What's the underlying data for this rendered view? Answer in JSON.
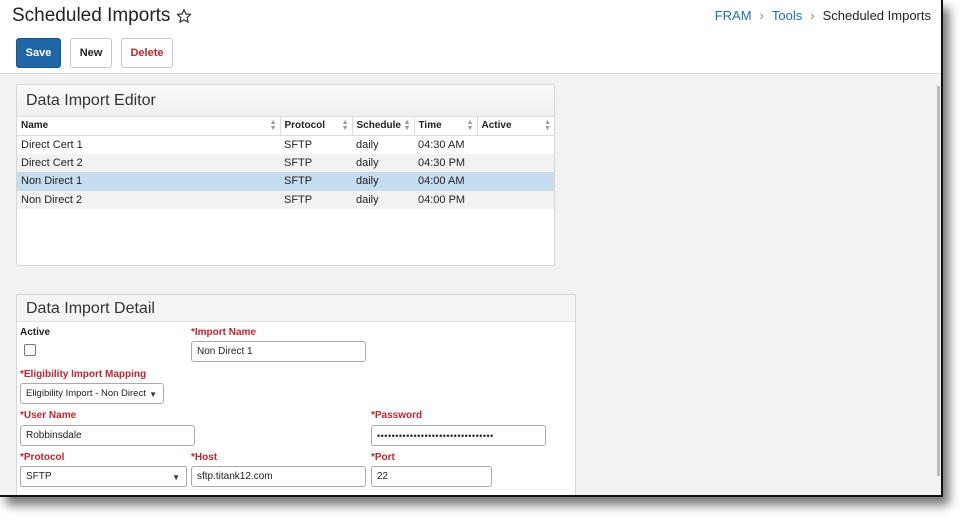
{
  "header": {
    "title": "Scheduled Imports",
    "breadcrumb": [
      "FRAM",
      "Tools",
      "Scheduled Imports"
    ]
  },
  "toolbar": {
    "save_label": "Save",
    "new_label": "New",
    "delete_label": "Delete"
  },
  "editor": {
    "title": "Data Import Editor",
    "columns": [
      "Name",
      "Protocol",
      "Schedule",
      "Time",
      "Active"
    ],
    "rows": [
      {
        "name": "Direct Cert 1",
        "protocol": "SFTP",
        "schedule": "daily",
        "time": "04:30 AM",
        "active": ""
      },
      {
        "name": "Direct Cert 2",
        "protocol": "SFTP",
        "schedule": "daily",
        "time": "04:30 PM",
        "active": ""
      },
      {
        "name": "Non Direct 1",
        "protocol": "SFTP",
        "schedule": "daily",
        "time": "04:00 AM",
        "active": ""
      },
      {
        "name": "Non Direct 2",
        "protocol": "SFTP",
        "schedule": "daily",
        "time": "04:00 PM",
        "active": ""
      }
    ],
    "selected_row": 2
  },
  "detail": {
    "title": "Data Import Detail",
    "active_label": "Active",
    "active_checked": false,
    "import_name_label": "*Import Name",
    "import_name_value": "Non Direct 1",
    "mapping_label": "*Eligibility Import Mapping",
    "mapping_value": "Eligibility Import - Non Direct",
    "user_name_label": "*User Name",
    "user_name_value": "Robbinsdale",
    "password_label": "*Password",
    "password_value": "••••••••••••••••••••••••••••••••",
    "protocol_label": "*Protocol",
    "protocol_value": "SFTP",
    "host_label": "*Host",
    "host_value": "sftp.titank12.com",
    "port_label": "*Port",
    "port_value": "22"
  },
  "colors": {
    "primary": "#1f66a6",
    "link": "#1f6fb6",
    "required": "#c0262d",
    "selected_row": "#c6dcef"
  },
  "icons": [
    "star-icon",
    "chevron-right-icon",
    "sort-icon",
    "chevron-down-icon"
  ]
}
